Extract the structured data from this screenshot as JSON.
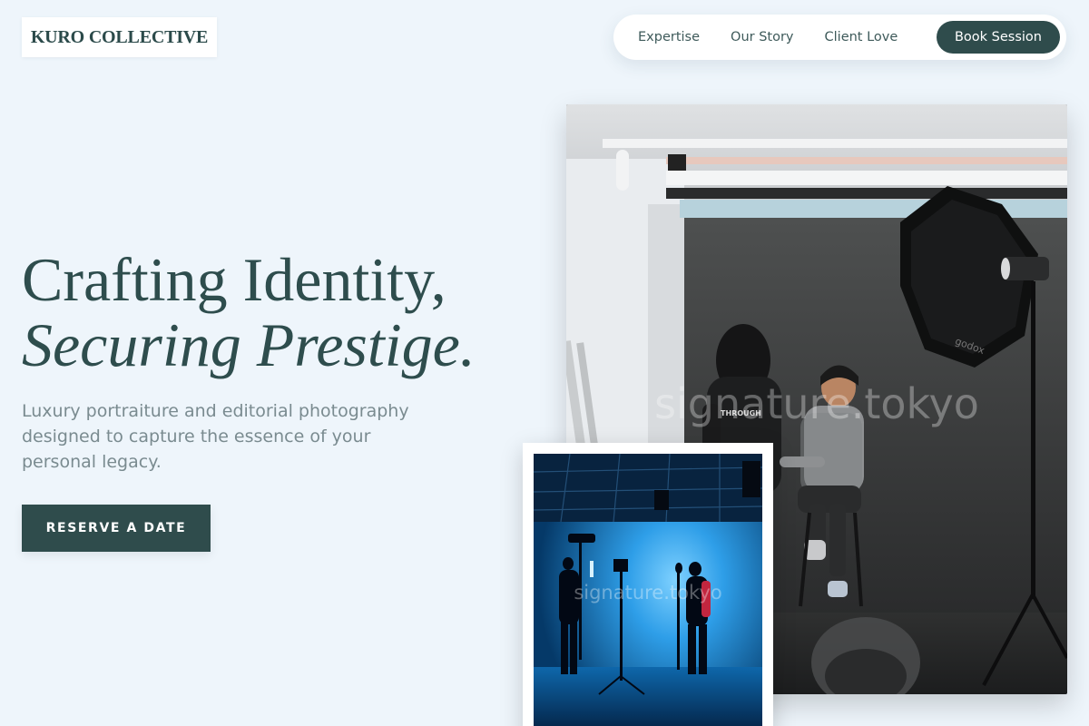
{
  "brand": {
    "name": "KURO COLLECTIVE"
  },
  "nav": {
    "links": [
      "Expertise",
      "Our Story",
      "Client Love"
    ],
    "cta_label": "Book Session"
  },
  "hero": {
    "headline_line1": "Crafting Identity,",
    "headline_line2": "Securing Prestige.",
    "subtitle": "Luxury portraiture and editorial photography designed to capture the essence of your personal legacy.",
    "cta_label": "RESERVE A DATE"
  },
  "images": {
    "main_watermark": "signature.tokyo",
    "inset_watermark": "signature.tokyo",
    "main_shirt_text": "THROUGH",
    "main_softbox_brand": "godox"
  },
  "colors": {
    "accent": "#2f4c4c",
    "background": "#eef5fb",
    "headline": "#2e4d4d",
    "subtitle": "#7a8b90"
  },
  "icons": []
}
